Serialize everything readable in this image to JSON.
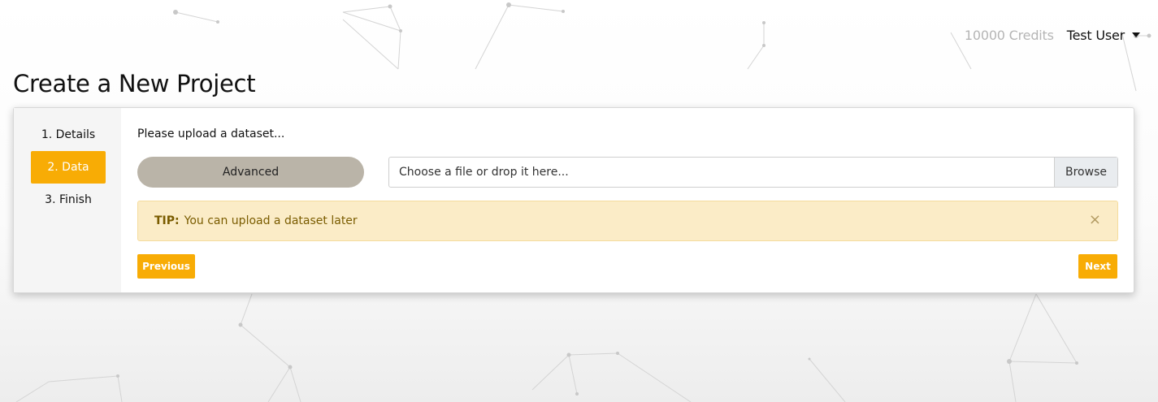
{
  "header": {
    "credits": "10000 Credits",
    "user_name": "Test User"
  },
  "page_title": "Create a New Project",
  "steps": [
    {
      "label": "1. Details",
      "active": false
    },
    {
      "label": "2. Data",
      "active": true
    },
    {
      "label": "3. Finish",
      "active": false
    }
  ],
  "data_step": {
    "prompt": "Please upload a dataset...",
    "advanced_label": "Advanced",
    "file_placeholder": "Choose a file or drop it here...",
    "browse_label": "Browse",
    "tip_label": "TIP:",
    "tip_text": "You can upload a dataset later",
    "close_glyph": "×",
    "previous_label": "Previous",
    "next_label": "Next"
  },
  "colors": {
    "accent": "#f8ac05",
    "advanced_button": "#bab4a8",
    "tip_background": "#fbecc7",
    "tip_text": "#7a5c00",
    "credits_text": "#b5b5b5"
  }
}
